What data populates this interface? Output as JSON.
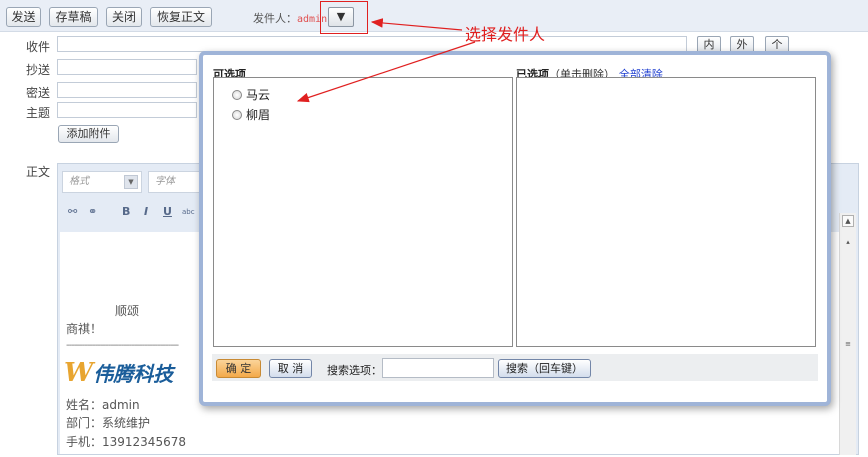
{
  "toolbar": {
    "send_label": "发送",
    "draft_label": "存草稿",
    "close_label": "关闭",
    "restore_label": "恢复正文",
    "sender_label": "发件人：",
    "sender_value": "admin",
    "dropdown_glyph": "▼"
  },
  "form": {
    "to_label": "收件",
    "cc_label": "抄送",
    "bcc_label": "密送",
    "subject_label": "主题",
    "attach_label": "添加附件",
    "body_label": "正文",
    "inner_btn": "内",
    "outer_btn": "外",
    "count_btn": "个"
  },
  "editor": {
    "format_placeholder": "格式",
    "font_placeholder": "字体",
    "bold": "B",
    "italic": "I",
    "underline": "U",
    "strike": "abc",
    "scroll_up": "▲",
    "scroll_mid": "≡",
    "regards": "顺颂",
    "business": "商祺！",
    "divider": "-------------------------------------------",
    "logo_mark": "W",
    "logo_text": "伟腾科技",
    "sig_name": "姓名：admin",
    "sig_dept": "部门：系统维护",
    "sig_phone": "手机：13912345678"
  },
  "annotation": {
    "text": "选择发件人",
    "color": "#e02020"
  },
  "dialog": {
    "available_title": "可选项",
    "selected_title": "已选项",
    "selected_hint": "（单击删除）",
    "clear_all": "全部清除",
    "options": [
      {
        "label": "马云"
      },
      {
        "label": "柳眉"
      }
    ],
    "ok_label": "确 定",
    "cancel_label": "取 消",
    "search_label": "搜索选项：",
    "search_value": "",
    "search_button": "搜索（回车键）"
  }
}
